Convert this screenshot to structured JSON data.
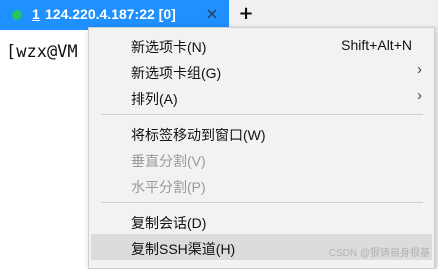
{
  "tab": {
    "number": "1",
    "title": "124.220.4.187:22 [0]",
    "close_glyph": "×",
    "status_color": "#22c55e"
  },
  "new_tab_glyph": "+",
  "terminal": {
    "prompt": "[wzx@VM"
  },
  "menu": {
    "items": [
      {
        "label": "新选项卡(N)",
        "shortcut": "Shift+Alt+N"
      },
      {
        "label": "新选项卡组(G)",
        "submenu": "›"
      },
      {
        "label": "排列(A)",
        "submenu": "›"
      },
      {
        "label": "将标签移动到窗口(W)"
      },
      {
        "label": "垂直分割(V)",
        "disabled": true
      },
      {
        "label": "水平分割(P)",
        "disabled": true
      },
      {
        "label": "复制会话(D)"
      },
      {
        "label": "复制SSH渠道(H)",
        "hovered": true
      }
    ]
  },
  "watermark": "CSDN @狠铸自身根基"
}
